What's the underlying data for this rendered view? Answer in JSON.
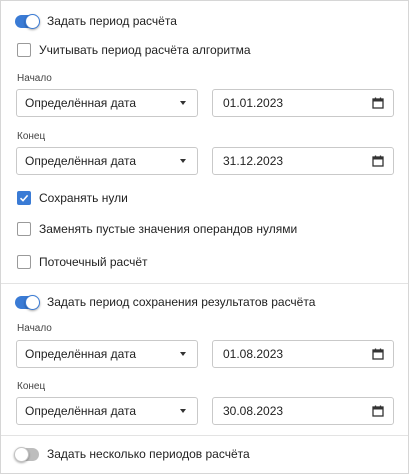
{
  "colors": {
    "accent": "#3a7bd5",
    "toggle_off": "#bdbdbd",
    "border": "#c9c9c9"
  },
  "period1": {
    "toggle_label": "Задать период расчёта",
    "toggle_on": true,
    "algorithm_checkbox_label": "Учитывать период расчёта алгоритма",
    "start_caption": "Начало",
    "start_mode": "Определённая дата",
    "start_date": "01.01.2023",
    "end_caption": "Конец",
    "end_mode": "Определённая дата",
    "end_date": "31.12.2023"
  },
  "options": {
    "keep_zeros_label": "Сохранять нули",
    "keep_zeros_checked": true,
    "replace_empty_label": "Заменять пустые значения операндов нулями",
    "replace_empty_checked": false,
    "stream_calc_label": "Поточечный расчёт",
    "stream_calc_checked": false
  },
  "period2": {
    "toggle_label": "Задать период сохранения результатов расчёта",
    "toggle_on": true,
    "start_caption": "Начало",
    "start_mode": "Определённая дата",
    "start_date": "01.08.2023",
    "end_caption": "Конец",
    "end_mode": "Определённая дата",
    "end_date": "30.08.2023"
  },
  "multi": {
    "toggle_label": "Задать несколько периодов расчёта",
    "toggle_on": false
  },
  "icons": {
    "dropdown": "chevron-down-icon",
    "calendar": "calendar-icon",
    "check": "check-icon"
  }
}
